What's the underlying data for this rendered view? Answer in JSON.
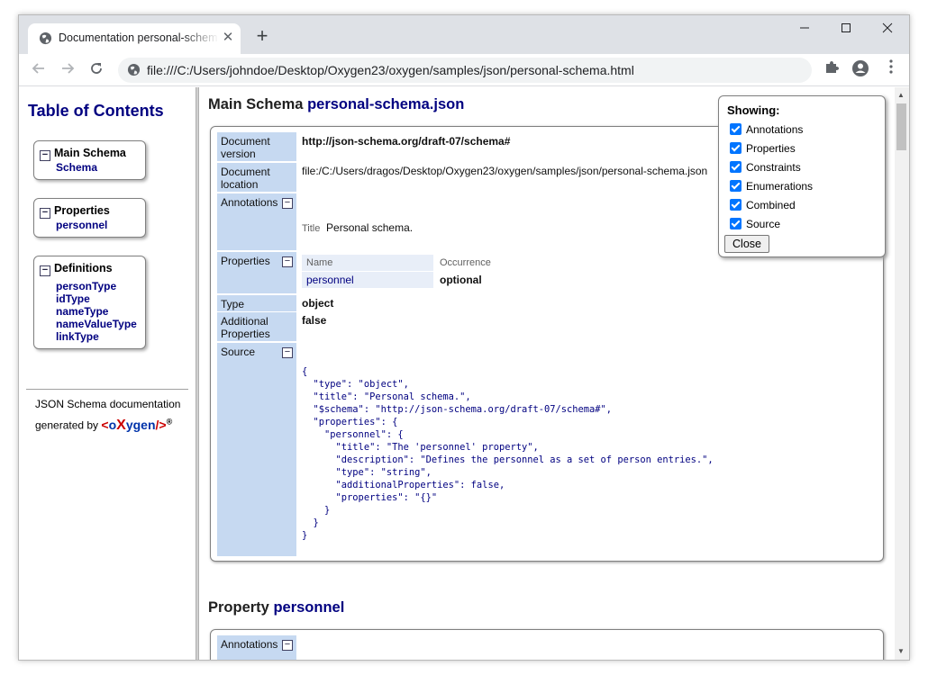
{
  "browser": {
    "tab_title": "Documentation personal-schema.html",
    "url": "file:///C:/Users/johndoe/Desktop/Oxygen23/oxygen/samples/json/personal-schema.html"
  },
  "sidebar": {
    "title": "Table of Contents",
    "groups": [
      {
        "label": "Main Schema",
        "items": [
          "Schema"
        ]
      },
      {
        "label": "Properties",
        "items": [
          "personnel"
        ]
      },
      {
        "label": "Definitions",
        "items": [
          "personType",
          "idType",
          "nameType",
          "nameValueType",
          "linkType"
        ]
      }
    ],
    "footer_line1": "JSON Schema documentation",
    "footer_line2": "generated by",
    "logo": {
      "lt": "<",
      "o": "o",
      "x": "X",
      "ygen": "ygen",
      "slash": "/",
      "gt": ">",
      "reg": "®"
    }
  },
  "main_schema": {
    "heading_prefix": "Main Schema",
    "heading_name": "personal-schema.json",
    "labels": {
      "doc_version": "Document version",
      "doc_location": "Document location",
      "annotations": "Annotations",
      "properties": "Properties",
      "type": "Type",
      "additional": "Additional Properties",
      "source": "Source"
    },
    "doc_version": "http://json-schema.org/draft-07/schema#",
    "doc_location": "file:/C:/Users/dragos/Desktop/Oxygen23/oxygen/samples/json/personal-schema.json",
    "annotation_key": "Title",
    "annotation_value": "Personal schema.",
    "props_header": {
      "name": "Name",
      "occurrence": "Occurrence"
    },
    "props_row": {
      "name": "personnel",
      "occurrence": "optional"
    },
    "type": "object",
    "additional": "false",
    "source": "{\n  \"type\": \"object\",\n  \"title\": \"Personal schema.\",\n  \"$schema\": \"http://json-schema.org/draft-07/schema#\",\n  \"properties\": {\n    \"personnel\": {\n      \"title\": \"The 'personnel' property\",\n      \"description\": \"Defines the personnel as a set of person entries.\",\n      \"type\": \"string\",\n      \"additionalProperties\": false,\n      \"properties\": \"{}\"\n    }\n  }\n}"
  },
  "property_section": {
    "heading_prefix": "Property",
    "heading_name": "personnel",
    "annotations_label": "Annotations"
  },
  "showing": {
    "title": "Showing:",
    "options": [
      "Annotations",
      "Properties",
      "Constraints",
      "Enumerations",
      "Combined",
      "Source"
    ],
    "close_label": "Close"
  }
}
